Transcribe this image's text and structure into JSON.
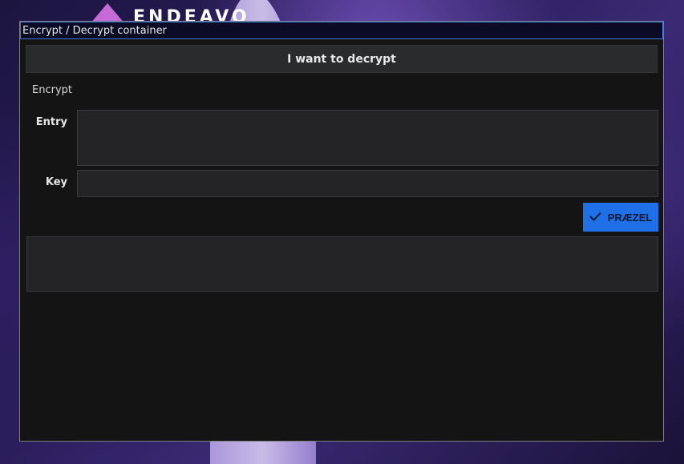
{
  "wallpaper": {
    "logo_text": "ENDEAVO"
  },
  "window": {
    "title": "Encrypt / Decrypt container"
  },
  "toggle": {
    "label": "I want to decrypt"
  },
  "mode": {
    "label": "Encrypt"
  },
  "form": {
    "entry_label": "Entry",
    "entry_value": "",
    "key_label": "Key",
    "key_value": "",
    "submit_label": "PRÆZEL",
    "submit_icon": "check-icon"
  },
  "output": {
    "value": ""
  },
  "colors": {
    "accent": "#1f6fe6",
    "titlebar_border": "#3f79d6",
    "window_bg": "#141414"
  }
}
